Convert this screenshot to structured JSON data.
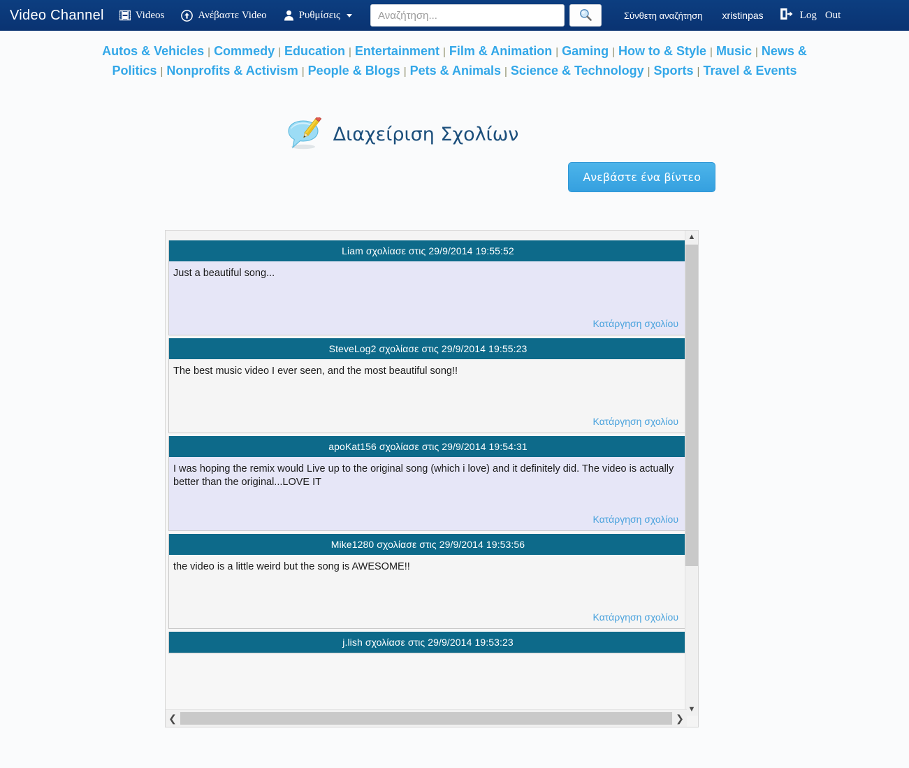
{
  "navbar": {
    "brand": "Video Channel",
    "items": [
      {
        "icon": "film-icon",
        "label": "Videos"
      },
      {
        "icon": "upload-circle-icon",
        "label": "Ανέβαστε  Video"
      },
      {
        "icon": "user-icon",
        "label": "Ρυθμίσεις",
        "caret": true
      }
    ],
    "search": {
      "value": "",
      "placeholder": "Αναζήτηση...",
      "button_icon": "magnifier-icon"
    },
    "advanced_search": "Σύνθετη αναζήτηση",
    "username": "xristinpas",
    "logout_icon": "logout-icon",
    "logout_word1": "Log",
    "logout_word2": "Out"
  },
  "categories": [
    "Autos & Vehicles",
    "Commedy",
    "Education",
    "Entertainment",
    "Film & Animation",
    "Gaming",
    "How to & Style",
    "Music",
    "News & Politics",
    "Nonprofits & Activism",
    "People & Blogs",
    "Pets & Animals",
    "Science & Technology",
    "Sports",
    "Travel & Events"
  ],
  "page": {
    "title": "Διαχείριση Σχολίων",
    "title_icon": "comment-pencil-icon",
    "upload_button": "Ανεβάστε ένα βίντεο"
  },
  "comments": {
    "delete_label": "Κατάργηση σχολίου",
    "items": [
      {
        "header": "Liam σχολίασε στις 29/9/2014 19:55:52",
        "author": "Liam",
        "timestamp": "29/9/2014 19:55:52",
        "text": "Just a beautiful song...",
        "shade": "alt"
      },
      {
        "header": "SteveLog2 σχολίασε στις 29/9/2014 19:55:23",
        "author": "SteveLog2",
        "timestamp": "29/9/2014 19:55:23",
        "text": "The best music video I ever seen, and the most beautiful song!!",
        "shade": "plain"
      },
      {
        "header": "apoKat156 σχολίασε στις 29/9/2014 19:54:31",
        "author": "apoKat156",
        "timestamp": "29/9/2014 19:54:31",
        "text": "I was hoping the remix would Live up to the original song (which i love) and it definitely did. The video is actually better than the original...LOVE IT",
        "shade": "alt"
      },
      {
        "header": "Mike1280 σχολίασε στις 29/9/2014 19:53:56",
        "author": "Mike1280",
        "timestamp": "29/9/2014 19:53:56",
        "text": "the video is a little weird but the song is AWESOME!!",
        "shade": "plain"
      },
      {
        "header": "j.lish σχολίασε στις 29/9/2014 19:53:23",
        "author": "j.lish",
        "timestamp": "29/9/2014 19:53:23",
        "text": "",
        "shade": "alt"
      }
    ]
  },
  "scrollbars": {
    "vertical_up": "▲",
    "vertical_down": "▼",
    "horizontal_left": "❮",
    "horizontal_right": "❯"
  },
  "colors": {
    "navbar": "#0c3e80",
    "category_link": "#33a7e8",
    "comment_header": "#0d6a8a",
    "upload_button": "#3fa9e5",
    "title_text": "#1c4f7c"
  }
}
